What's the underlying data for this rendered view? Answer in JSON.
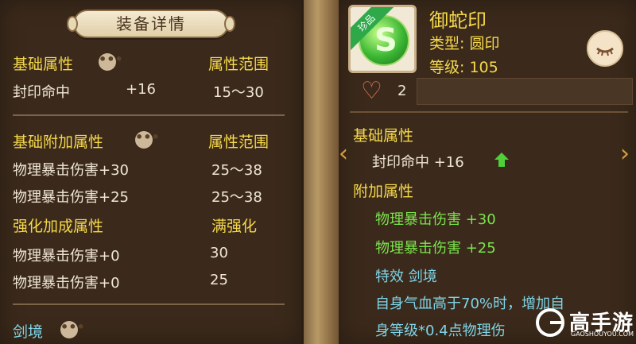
{
  "left": {
    "title": "装备详情",
    "base_header": "基础属性",
    "base_range_header": "属性范围",
    "base_rows": [
      {
        "name": "封印命中",
        "val": "+16",
        "range": "15～30"
      }
    ],
    "extra_header": "基础附加属性",
    "extra_range_header": "属性范围",
    "extra_rows": [
      {
        "name": "物理暴击伤害+30",
        "range": "25～38"
      },
      {
        "name": "物理暴击伤害+25",
        "range": "25～38"
      }
    ],
    "enhance_header": "强化加成属性",
    "enhance_max_header": "满强化",
    "enhance_rows": [
      {
        "name": "物理暴击伤害+0",
        "max": "30"
      },
      {
        "name": "物理暴击伤害+0",
        "max": "25"
      }
    ],
    "realm_label": "剑境",
    "more_symbol": "•••"
  },
  "right": {
    "ribbon": "珍品",
    "item_name": "御蛇印",
    "type_line": "类型: 圆印",
    "level_line": "等级: 105",
    "likes": "2",
    "base_header": "基础属性",
    "base_stat": "封印命中  +16",
    "extra_header": "附加属性",
    "extra_stats": [
      "物理暴击伤害  +30",
      "物理暴击伤害  +25"
    ],
    "effect_line": "特效  剑境",
    "effect_desc1": "自身气血高于70%时，增加自",
    "effect_desc2": "身等级*0.4点物理伤"
  },
  "watermark": {
    "brand": "高手游",
    "url": "GAOSHOUYOU.COM"
  },
  "colors": {
    "gold": "#f5d84a",
    "green": "#7be34e",
    "cyan": "#7fd4e8",
    "panel": "#3b2a1b"
  }
}
